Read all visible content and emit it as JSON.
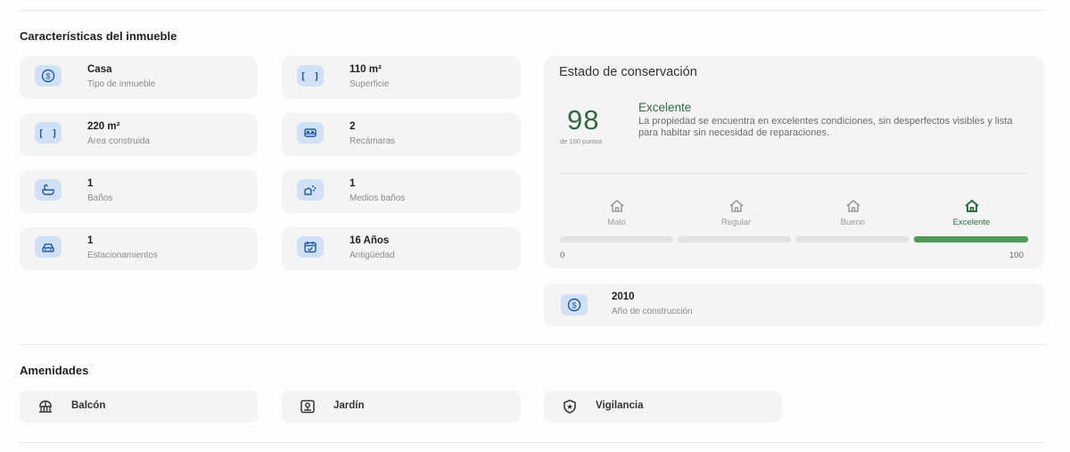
{
  "characteristics": {
    "title": "Características del inmueble",
    "items": [
      {
        "value": "Casa",
        "label": "Tipo de inmueble",
        "icon": "dollar-coin-icon"
      },
      {
        "value": "110 m²",
        "label": "Superficie",
        "icon": "brackets-icon"
      },
      {
        "value": "220 m²",
        "label": "Área construida",
        "icon": "brackets-icon"
      },
      {
        "value": "2",
        "label": "Recámaras",
        "icon": "bed-icon"
      },
      {
        "value": "1",
        "label": "Baños",
        "icon": "bathtub-icon"
      },
      {
        "value": "1",
        "label": "Medios baños",
        "icon": "hand-washing-icon"
      },
      {
        "value": "1",
        "label": "Estacionamientos",
        "icon": "car-icon"
      },
      {
        "value": "16 Años",
        "label": "Antigüedad",
        "icon": "calendar-icon"
      }
    ]
  },
  "conservation": {
    "title": "Estado de conservación",
    "score": "98",
    "score_sub": "de 100 puntos",
    "rating": "Excelente",
    "description": "La propiedad se encuentra en excelentes condiciones, sin desperfectos visibles y lista para habitar sin necesidad de reparaciones.",
    "levels": [
      "Malo",
      "Regular",
      "Bueno",
      "Excelente"
    ],
    "active_level": 3,
    "scale_min": "0",
    "scale_max": "100",
    "accent_color": "#2e6a3f",
    "bar_color": "#4f9b55"
  },
  "year_built": {
    "value": "2010",
    "label": "Año de construcción",
    "icon": "dollar-coin-icon"
  },
  "amenities": {
    "title": "Amenidades",
    "items": [
      {
        "label": "Balcón",
        "icon": "balcony-icon"
      },
      {
        "label": "Jardín",
        "icon": "garden-icon"
      },
      {
        "label": "Vigilancia",
        "icon": "shield-star-icon"
      }
    ]
  }
}
